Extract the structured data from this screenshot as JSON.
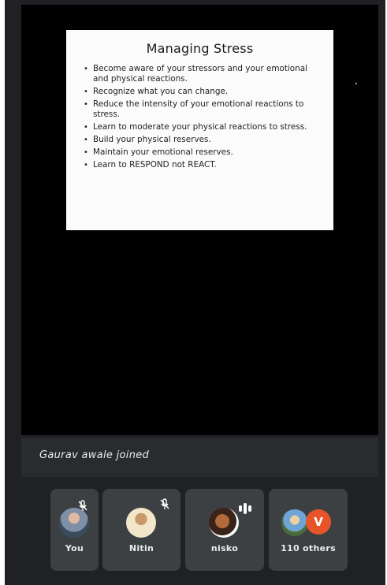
{
  "slide": {
    "title": "Managing Stress",
    "bullets": [
      "Become aware of your stressors and your emotional and physical reactions.",
      "Recognize what you can change.",
      "Reduce the intensity of your emotional reactions to stress.",
      "Learn to moderate your physical reactions to stress.",
      "Build your physical reserves.",
      "Maintain your emotional reserves.",
      "Learn to RESPOND not REACT."
    ]
  },
  "notification": {
    "text": "Gaurav awale joined"
  },
  "participants": [
    {
      "label": "You",
      "muted": true
    },
    {
      "label": "Nitin",
      "muted": true
    },
    {
      "label": "nisko",
      "speaking": true
    },
    {
      "label": "110 others",
      "extra_initial": "V"
    }
  ],
  "colors": {
    "background": "#202124",
    "tile": "#3c4043",
    "accent": "#e8542a"
  }
}
